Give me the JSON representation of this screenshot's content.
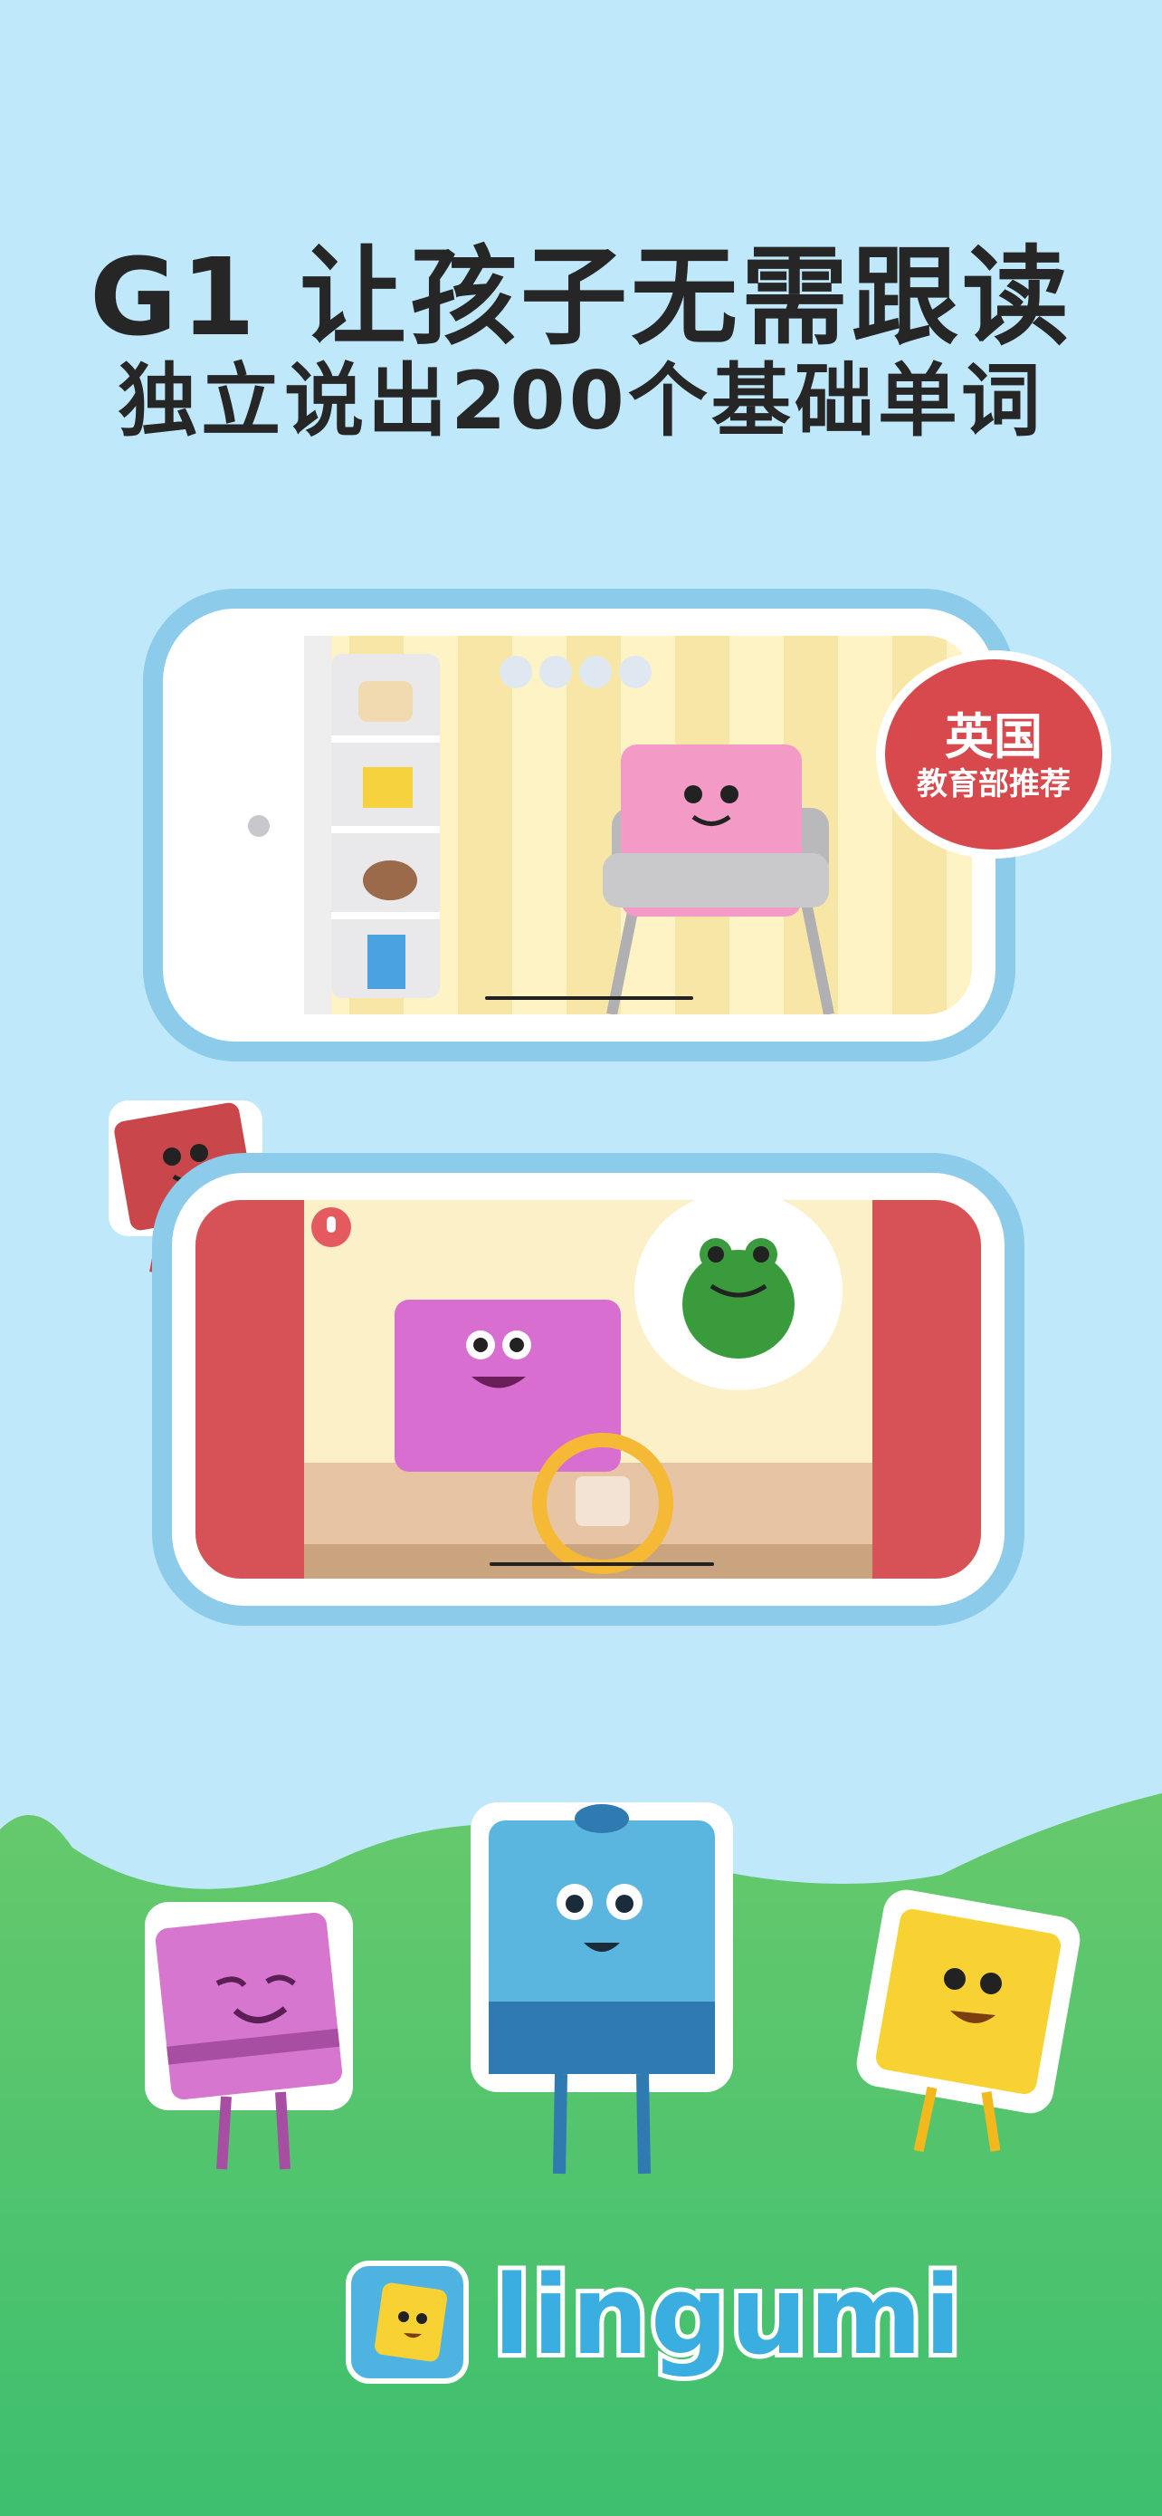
{
  "headline": {
    "line1": "G1 让孩子无需跟读",
    "line2": "独立说出200个基础单词"
  },
  "badge": {
    "line1": "英国",
    "line2": "教育部推荐"
  },
  "brand": {
    "name": "lingumi"
  },
  "colors": {
    "sky": "#bfe8fb",
    "phone_frame": "#8ccbea",
    "badge_red": "#d7494c",
    "grass": "#4cc46c",
    "brand_blue": "#3aaee0"
  },
  "icons": {
    "mic": "mic-icon",
    "frog": "frog-icon"
  }
}
